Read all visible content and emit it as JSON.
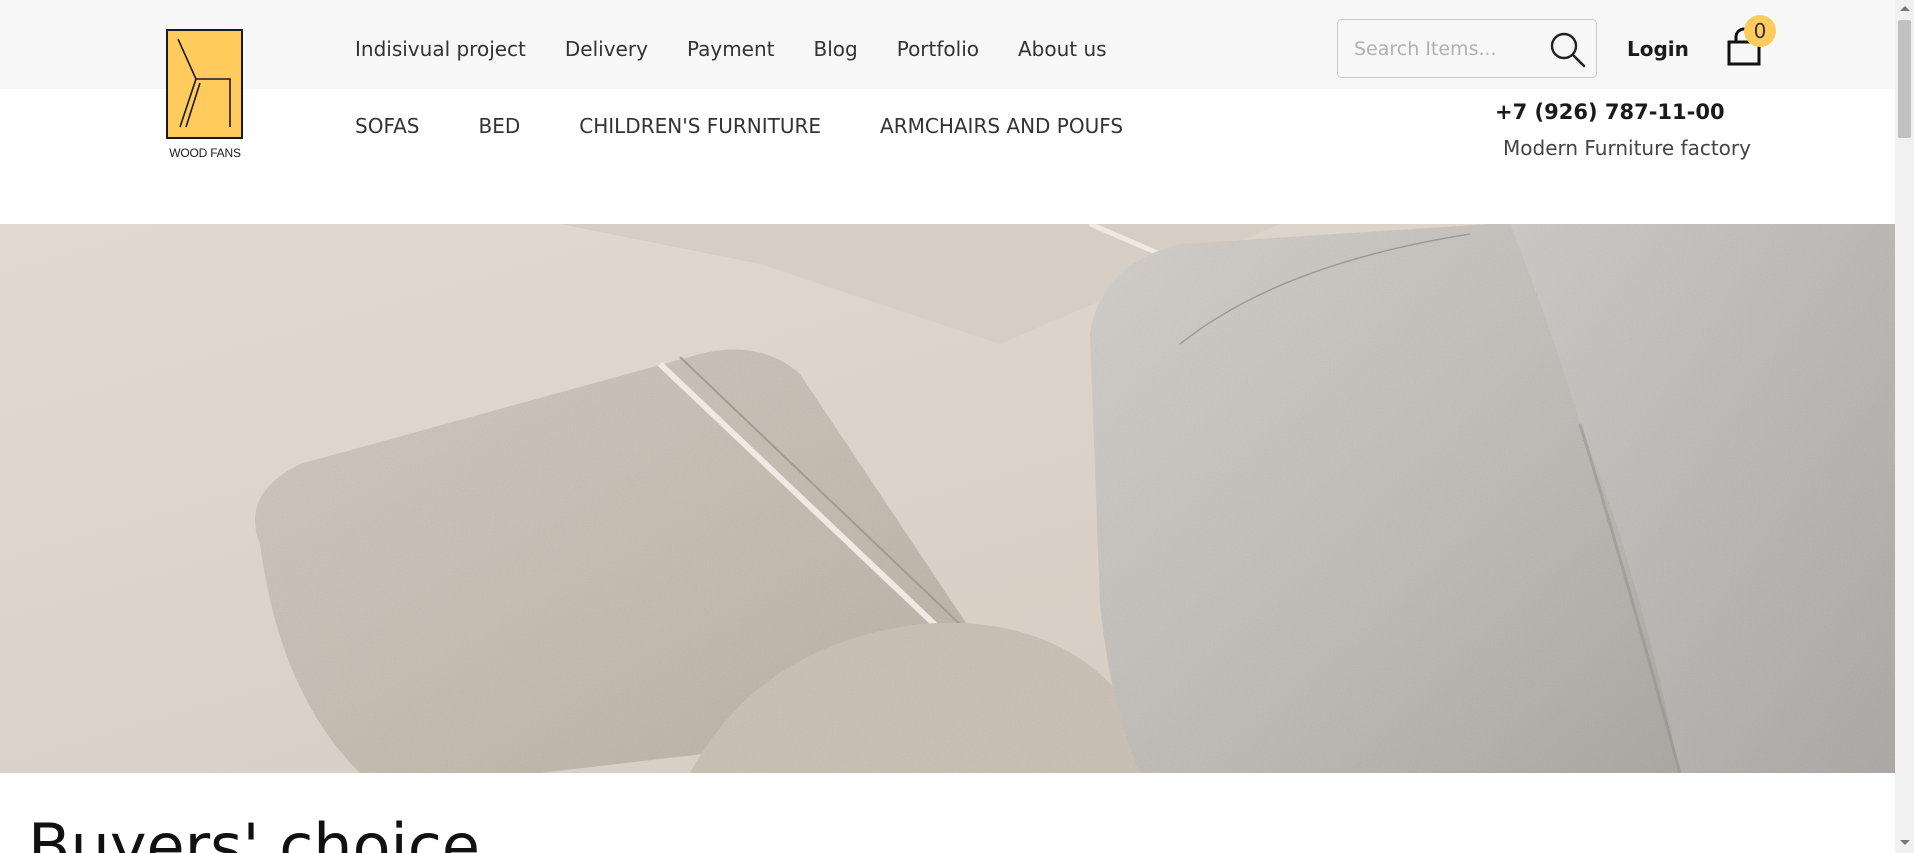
{
  "brand": {
    "name": "WOOD FANS",
    "logo_color": "#ffcb5c"
  },
  "top_nav": [
    {
      "label": "Indisivual project"
    },
    {
      "label": "Delivery"
    },
    {
      "label": "Payment"
    },
    {
      "label": "Blog"
    },
    {
      "label": "Portfolio"
    },
    {
      "label": "About us"
    }
  ],
  "search": {
    "placeholder": "Search Items...",
    "value": "",
    "icon": "search-icon"
  },
  "account": {
    "login_label": "Login"
  },
  "cart": {
    "icon": "shopping-bag-icon",
    "count": "0",
    "badge_color": "#ffcb5c"
  },
  "categories": [
    {
      "label": "SOFAS"
    },
    {
      "label": "BED"
    },
    {
      "label": "CHILDREN'S FURNITURE"
    },
    {
      "label": "ARMCHAIRS AND POUFS"
    }
  ],
  "contact": {
    "phone": "+7 (926) 787-11-00",
    "tagline": "Modern Furniture factory"
  },
  "hero": {
    "image": "beige-boucle-sofa-closeup"
  },
  "sections": {
    "buyers_choice_title": "Buyers' choice"
  }
}
